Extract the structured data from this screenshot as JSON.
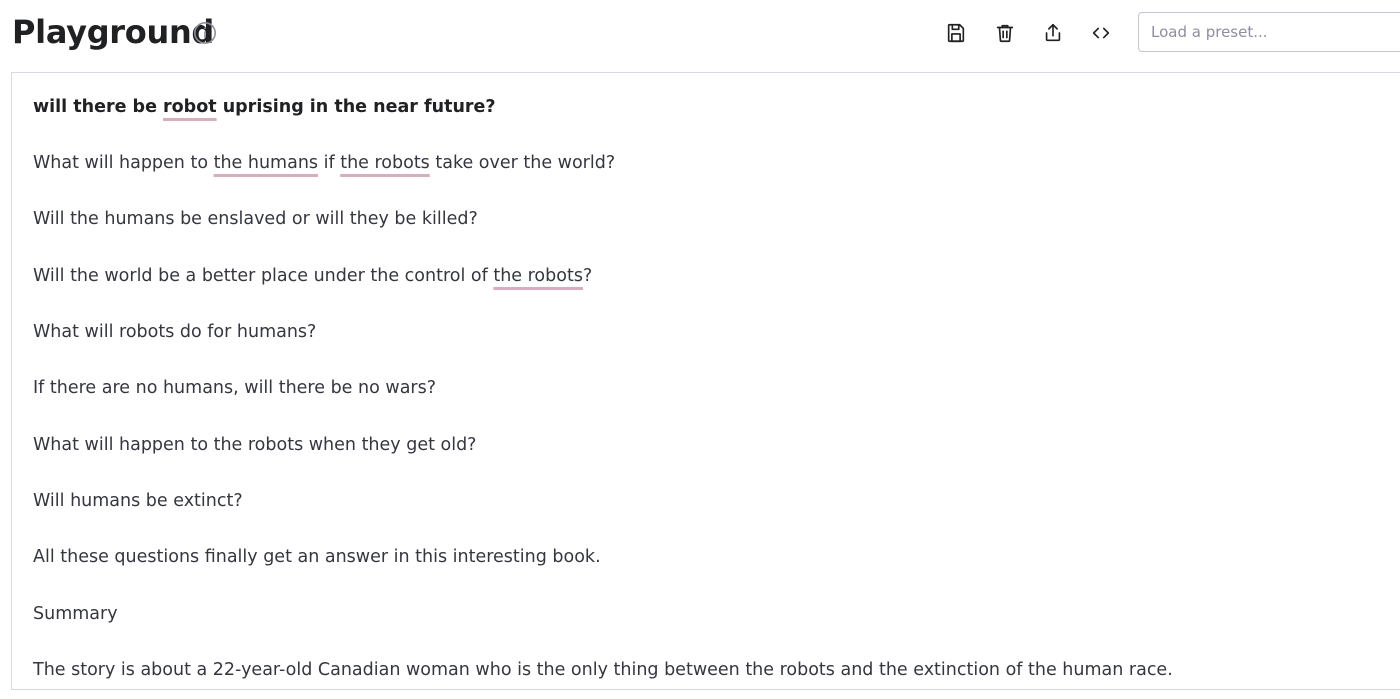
{
  "header": {
    "title": "Playground",
    "preset_placeholder": "Load a preset...",
    "icons": [
      "info-icon",
      "save-icon",
      "trash-icon",
      "share-icon",
      "code-icon"
    ]
  },
  "editor": {
    "spellcheck_underline_color": "#d7aebf",
    "prompt": {
      "a": "will there be ",
      "b": "robot",
      "c": " uprising in the near future?"
    },
    "l1": {
      "a": "What will happen to ",
      "b": "the humans",
      "c": " if ",
      "d": "the robots",
      "e": " take over the world?"
    },
    "l2": "Will the humans be enslaved or will they be killed?",
    "l3": {
      "a": "Will the world be a better place under the control of ",
      "b": "the robots",
      "c": "?"
    },
    "l4": "What will robots do for humans?",
    "l5": "If there are no humans, will there be no wars?",
    "l6": "What will happen to the robots when they get old?",
    "l7": "Will humans be extinct?",
    "l8": "All these questions finally get an answer in this interesting book.",
    "l9": "Summary",
    "l10": "The story is about a 22-year-old Canadian woman who is the only thing between the robots and the extinction of the human race."
  }
}
